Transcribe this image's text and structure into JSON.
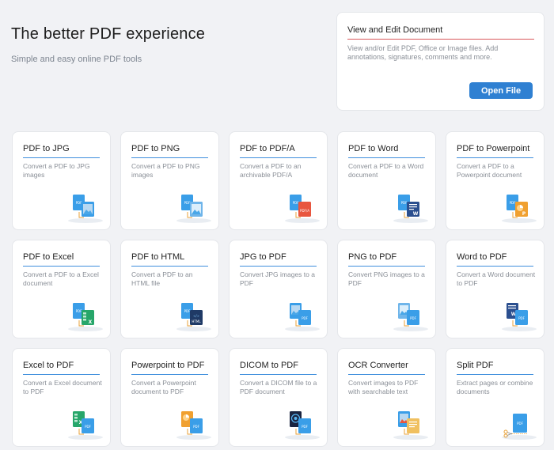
{
  "hero": {
    "title": "The better PDF experience",
    "subtitle": "Simple and easy online PDF tools"
  },
  "view_card": {
    "title": "View and Edit Document",
    "description": "View and/or Edit PDF, Office or Image files. Add annotations, signatures, comments and more.",
    "button_label": "Open File"
  },
  "tools": [
    {
      "title": "PDF to JPG",
      "desc": "Convert a PDF to JPG images",
      "icon": "pdf-to-jpg-icon"
    },
    {
      "title": "PDF to PNG",
      "desc": "Convert a PDF to PNG images",
      "icon": "pdf-to-png-icon"
    },
    {
      "title": "PDF to PDF/A",
      "desc": "Convert a PDF to an archivable PDF/A",
      "icon": "pdf-to-pdfa-icon"
    },
    {
      "title": "PDF to Word",
      "desc": "Convert a PDF to a Word document",
      "icon": "pdf-to-word-icon"
    },
    {
      "title": "PDF to Powerpoint",
      "desc": "Convert a PDF to a Powerpoint document",
      "icon": "pdf-to-powerpoint-icon"
    },
    {
      "title": "PDF to Excel",
      "desc": "Convert a PDF to a Excel document",
      "icon": "pdf-to-excel-icon"
    },
    {
      "title": "PDF to HTML",
      "desc": "Convert a PDF to an HTML file",
      "icon": "pdf-to-html-icon"
    },
    {
      "title": "JPG to PDF",
      "desc": "Convert JPG images to a PDF",
      "icon": "jpg-to-pdf-icon"
    },
    {
      "title": "PNG to PDF",
      "desc": "Convert PNG images to a PDF",
      "icon": "png-to-pdf-icon"
    },
    {
      "title": "Word to PDF",
      "desc": "Convert a Word document to PDF",
      "icon": "word-to-pdf-icon"
    },
    {
      "title": "Excel to PDF",
      "desc": "Convert a Excel document to PDF",
      "icon": "excel-to-pdf-icon"
    },
    {
      "title": "Powerpoint to PDF",
      "desc": "Convert a Powerpoint document to PDF",
      "icon": "powerpoint-to-pdf-icon"
    },
    {
      "title": "DICOM to PDF",
      "desc": "Convert a DICOM file to a PDF document",
      "icon": "dicom-to-pdf-icon"
    },
    {
      "title": "OCR Converter",
      "desc": "Convert images to PDF with searchable text",
      "icon": "ocr-converter-icon"
    },
    {
      "title": "Split PDF",
      "desc": "Extract pages or combine documents",
      "icon": "split-pdf-icon"
    }
  ],
  "colors": {
    "page_bg": "#f1f2f5",
    "accent_blue": "#2f80d2",
    "title_underline_blue": "#3f8fdd",
    "view_card_underline": "#d9585b",
    "pdf_doc": "#3a9ee8",
    "word": "#2b4f8f",
    "excel": "#27a66a",
    "powerpoint": "#f0a030",
    "pdfa": "#e8563f",
    "html": "#1f3a66",
    "image": "#b7d8f2"
  }
}
